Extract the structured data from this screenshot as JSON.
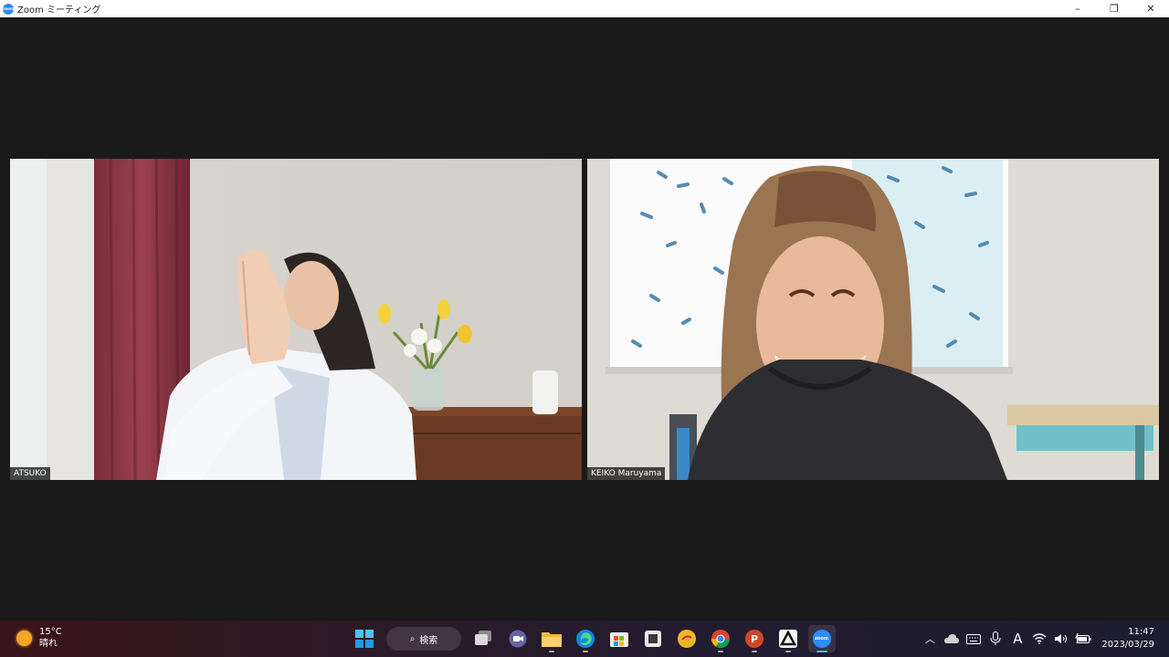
{
  "window": {
    "title": "Zoom ミーティング",
    "app_icon_text": "zoom",
    "minimize": "–",
    "maximize": "❐",
    "close": "✕"
  },
  "participants": [
    {
      "name": "ATSUKO"
    },
    {
      "name": "KEIKO Maruyama"
    }
  ],
  "taskbar": {
    "weather_temp": "15°C",
    "weather_condition": "晴れ",
    "search_label": "検索",
    "zoom_label": "zoom",
    "time": "11:47",
    "date": "2023/03/29",
    "ime_mode": "A",
    "accent": "#5ab0ff"
  }
}
